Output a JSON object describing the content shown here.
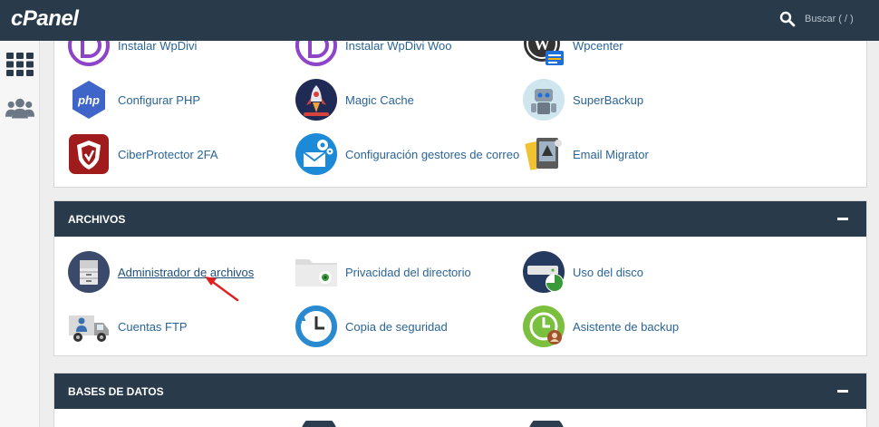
{
  "header": {
    "logo": "cPanel",
    "search_placeholder": "Buscar ( / )"
  },
  "sidebar": {
    "items": [
      {
        "name": "apps-grid-icon"
      },
      {
        "name": "users-icon"
      }
    ]
  },
  "top_section": {
    "rows": [
      [
        {
          "label": "Instalar WpDivi"
        },
        {
          "label": "Instalar WpDivi Woo"
        },
        {
          "label": "Wpcenter"
        }
      ],
      [
        {
          "label": "Configurar PHP"
        },
        {
          "label": "Magic Cache"
        },
        {
          "label": "SuperBackup"
        }
      ],
      [
        {
          "label": "CiberProtector 2FA"
        },
        {
          "label": "Configuración gestores de correo"
        },
        {
          "label": "Email Migrator"
        }
      ]
    ]
  },
  "archivos": {
    "title": "ARCHIVOS",
    "items": [
      {
        "label": "Administrador de archivos"
      },
      {
        "label": "Privacidad del directorio"
      },
      {
        "label": "Uso del disco"
      },
      {
        "label": "Cuentas FTP"
      },
      {
        "label": "Copia de seguridad"
      },
      {
        "label": "Asistente de backup"
      }
    ]
  },
  "bases_de_datos": {
    "title": "BASES DE DATOS"
  },
  "colors": {
    "header_bg": "#293a4a",
    "link": "#2a6496",
    "arrow": "#e02020"
  }
}
